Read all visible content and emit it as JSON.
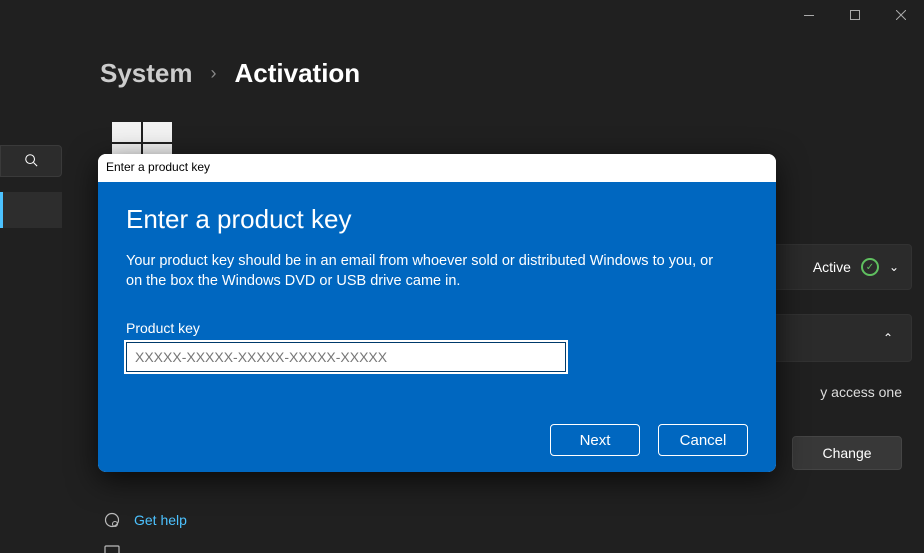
{
  "titlebar": {
    "minimize": "—",
    "maximize": "□",
    "close": "✕"
  },
  "breadcrumb": {
    "system": "System",
    "chevron": "›",
    "activation": "Activation"
  },
  "status": {
    "active": "Active",
    "check": "✓",
    "chev_down": "⌄",
    "chev_up": "⌃"
  },
  "peek": "y access one",
  "change_label": "Change",
  "help": {
    "label": "Get help"
  },
  "modal": {
    "titlebar": "Enter a product key",
    "heading": "Enter a product key",
    "description": "Your product key should be in an email from whoever sold or distributed Windows to you, or on the box the Windows DVD or USB drive came in.",
    "input_label": "Product key",
    "input_placeholder": "XXXXX-XXXXX-XXXXX-XXXXX-XXXXX",
    "next": "Next",
    "cancel": "Cancel"
  }
}
